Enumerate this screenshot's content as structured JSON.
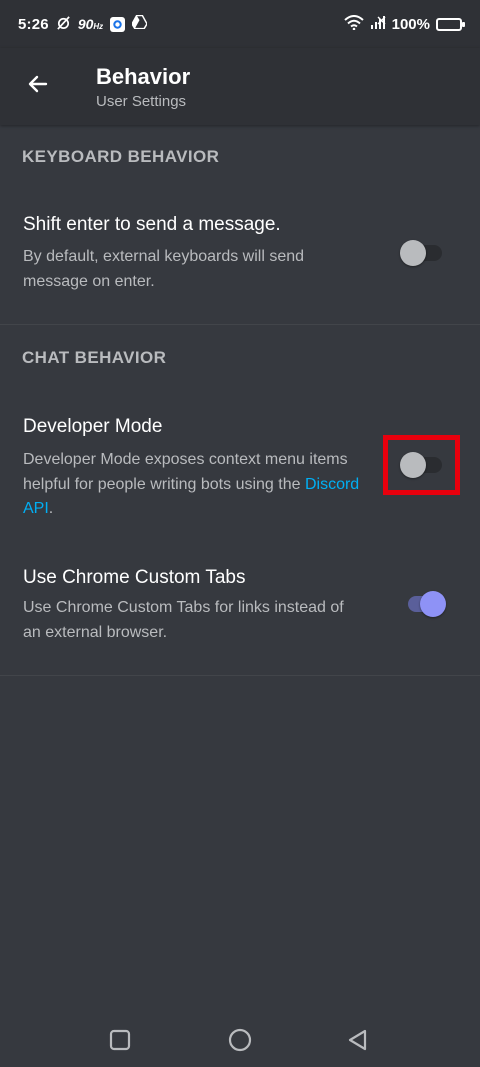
{
  "status_bar": {
    "time": "5:26",
    "refresh_rate": "90",
    "refresh_unit": "Hz",
    "battery": "100%"
  },
  "header": {
    "title": "Behavior",
    "subtitle": "User Settings"
  },
  "sections": [
    {
      "header": "KEYBOARD BEHAVIOR",
      "items": [
        {
          "title": "Shift enter to send a message.",
          "description": "By default, external keyboards will send message on enter.",
          "enabled": false
        }
      ]
    },
    {
      "header": "CHAT BEHAVIOR",
      "items": [
        {
          "title": "Developer Mode",
          "description_prefix": "Developer Mode exposes context menu items helpful for people writing bots using the ",
          "link_text": "Discord API",
          "description_suffix": ".",
          "enabled": false
        },
        {
          "title": "Use Chrome Custom Tabs",
          "description": "Use Chrome Custom Tabs for links instead of an external browser.",
          "enabled": true
        }
      ]
    }
  ],
  "colors": {
    "background": "#36393f",
    "header_bg": "#2f3136",
    "accent": "#8e92f6",
    "link": "#00aff4",
    "highlight": "#e8000d"
  }
}
